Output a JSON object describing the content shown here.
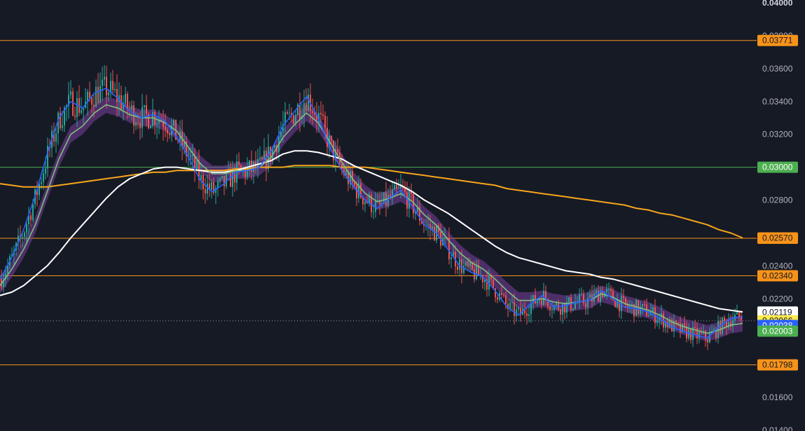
{
  "chart_data": {
    "type": "candlestick",
    "ylim": [
      0.014,
      0.04
    ],
    "y_ticks": [
      "0.01400",
      "0.01600",
      "0.02200",
      "0.02400",
      "0.02800",
      "0.03200",
      "0.03400",
      "0.03600",
      "0.03800",
      "0.04000"
    ],
    "horizontal_levels": [
      {
        "value": 0.03771,
        "label": "0.03771",
        "color": "#f7931a"
      },
      {
        "value": 0.03,
        "label": "0.03000",
        "color": "#4caf50"
      },
      {
        "value": 0.02568,
        "label": "0.02568",
        "color": "#f7931a"
      },
      {
        "value": 0.0234,
        "label": "0.02340",
        "color": "#f7931a"
      },
      {
        "value": 0.01798,
        "label": "0.01798",
        "color": "#f7931a"
      }
    ],
    "price_tags": [
      {
        "value": 0.0257,
        "label": "0.02570",
        "bg": "#f7931a",
        "fg": "#131722"
      },
      {
        "value": 0.02119,
        "label": "0.02119",
        "bg": "#ffffff",
        "fg": "#131722"
      },
      {
        "value": 0.02066,
        "label": "0.02066",
        "sublabel": "03:05:13",
        "bg": "#fee94e",
        "fg": "#131722"
      },
      {
        "value": 0.02038,
        "label": "0.02038",
        "bg": "#2962ff",
        "fg": "#ffffff"
      },
      {
        "value": 0.02003,
        "label": "0.02003",
        "bg": "#4caf50",
        "fg": "#ffffff"
      }
    ],
    "last_price": 0.02066,
    "series": [
      {
        "key": "ma_fast",
        "color": "#2962ff",
        "values": [
          0.0232,
          0.0245,
          0.0262,
          0.0283,
          0.0308,
          0.033,
          0.034,
          0.0336,
          0.0345,
          0.0348,
          0.0342,
          0.0334,
          0.033,
          0.0332,
          0.0328,
          0.0318,
          0.0306,
          0.0292,
          0.0285,
          0.029,
          0.0297,
          0.0298,
          0.03,
          0.031,
          0.0325,
          0.0334,
          0.0343,
          0.033,
          0.0312,
          0.0298,
          0.0288,
          0.028,
          0.0275,
          0.0281,
          0.0286,
          0.0276,
          0.0265,
          0.026,
          0.025,
          0.024,
          0.0236,
          0.0233,
          0.0225,
          0.0215,
          0.021,
          0.0217,
          0.0222,
          0.0215,
          0.0216,
          0.0218,
          0.0219,
          0.0225,
          0.022,
          0.0215,
          0.0214,
          0.0212,
          0.0208,
          0.0203,
          0.02,
          0.0198,
          0.0196,
          0.0203,
          0.0208,
          0.0209
        ]
      },
      {
        "key": "ma_mid",
        "color": "#7fbf7f",
        "values": [
          0.0228,
          0.0238,
          0.025,
          0.0265,
          0.0285,
          0.0305,
          0.032,
          0.0325,
          0.0333,
          0.0338,
          0.0336,
          0.0332,
          0.033,
          0.033,
          0.0327,
          0.0322,
          0.0312,
          0.0302,
          0.0296,
          0.0296,
          0.0298,
          0.0298,
          0.03,
          0.0306,
          0.0318,
          0.0326,
          0.0333,
          0.0327,
          0.0315,
          0.0303,
          0.0292,
          0.0284,
          0.0279,
          0.0281,
          0.0284,
          0.0279,
          0.0271,
          0.0265,
          0.0256,
          0.0248,
          0.0242,
          0.0238,
          0.0232,
          0.0225,
          0.0219,
          0.0219,
          0.022,
          0.0218,
          0.0217,
          0.0218,
          0.0219,
          0.0223,
          0.0221,
          0.0217,
          0.0215,
          0.0213,
          0.021,
          0.0206,
          0.0203,
          0.0201,
          0.0199,
          0.0201,
          0.0204,
          0.0205
        ]
      },
      {
        "key": "ma_slow",
        "color": "#ffffff",
        "values": [
          0.0222,
          0.0224,
          0.0228,
          0.0234,
          0.024,
          0.0248,
          0.0257,
          0.0265,
          0.0273,
          0.0281,
          0.0288,
          0.0293,
          0.0296,
          0.0299,
          0.03,
          0.03,
          0.0299,
          0.0298,
          0.0297,
          0.0297,
          0.0298,
          0.03,
          0.0302,
          0.0304,
          0.0308,
          0.031,
          0.031,
          0.0309,
          0.0307,
          0.0305,
          0.0301,
          0.0298,
          0.0295,
          0.0292,
          0.0289,
          0.0285,
          0.028,
          0.0276,
          0.0272,
          0.0267,
          0.0262,
          0.0257,
          0.0252,
          0.0248,
          0.0245,
          0.0243,
          0.0241,
          0.0239,
          0.0237,
          0.0236,
          0.0235,
          0.0233,
          0.0232,
          0.023,
          0.0228,
          0.0226,
          0.0224,
          0.0222,
          0.022,
          0.0218,
          0.0216,
          0.0214,
          0.0213,
          0.0212
        ]
      },
      {
        "key": "ma_long",
        "color": "#f7a51c",
        "values": [
          0.029,
          0.0289,
          0.0288,
          0.0288,
          0.0288,
          0.0289,
          0.029,
          0.0291,
          0.0292,
          0.0293,
          0.0294,
          0.0295,
          0.0296,
          0.0297,
          0.0297,
          0.0298,
          0.0298,
          0.0298,
          0.0298,
          0.0298,
          0.0299,
          0.0299,
          0.03,
          0.03,
          0.03,
          0.0301,
          0.0301,
          0.0301,
          0.0301,
          0.03,
          0.03,
          0.03,
          0.0299,
          0.0298,
          0.0297,
          0.0296,
          0.0295,
          0.0294,
          0.0293,
          0.0292,
          0.0291,
          0.029,
          0.0289,
          0.0287,
          0.0286,
          0.0285,
          0.0284,
          0.0283,
          0.0282,
          0.0281,
          0.028,
          0.0279,
          0.0278,
          0.0277,
          0.0275,
          0.0274,
          0.0272,
          0.0271,
          0.0269,
          0.0267,
          0.0265,
          0.0262,
          0.026,
          0.0257
        ]
      }
    ],
    "ribbon": {
      "color": "#7b3fa0",
      "half_width": 0.0005
    },
    "colors": {
      "up": "#26a69a",
      "down": "#ef5350",
      "background": "#161a25"
    }
  }
}
